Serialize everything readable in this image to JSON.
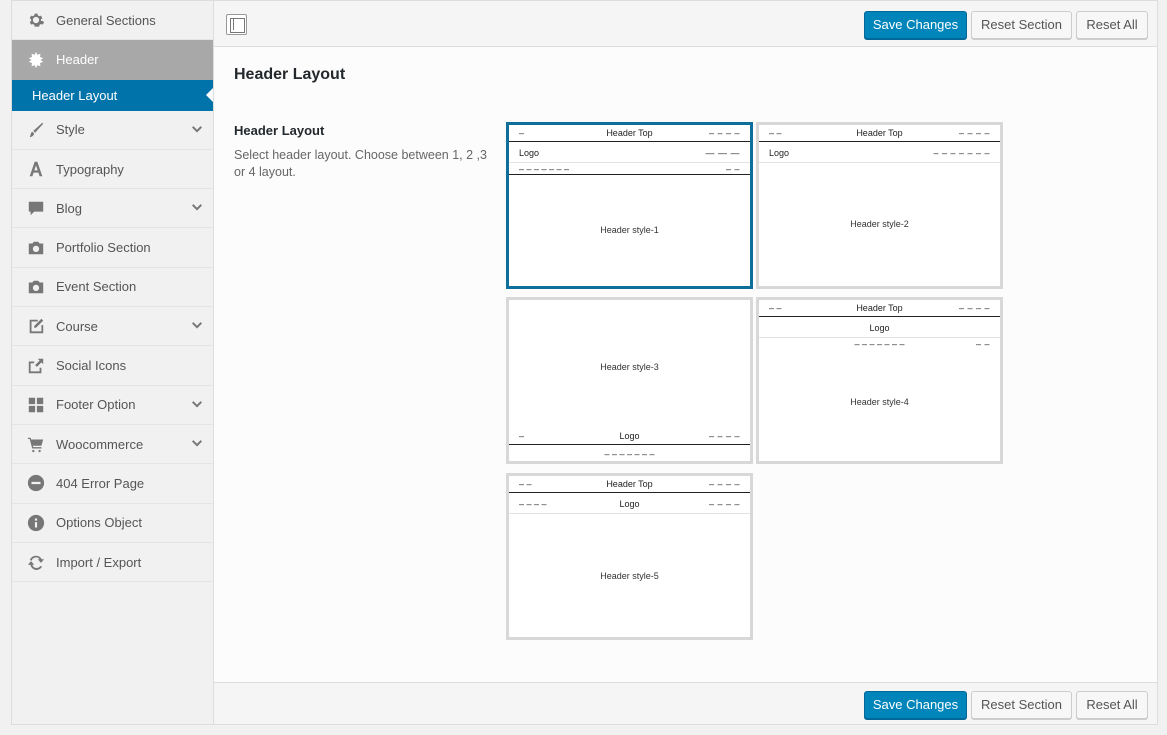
{
  "sidebar": {
    "items": [
      {
        "label": "General Sections",
        "icon": "gear-icon",
        "chevron": false
      },
      {
        "label": "Header",
        "icon": "sun-icon",
        "chevron": false,
        "active": true
      },
      {
        "label": "Style",
        "icon": "brush-icon",
        "chevron": true
      },
      {
        "label": "Typography",
        "icon": "font-icon",
        "chevron": false
      },
      {
        "label": "Blog",
        "icon": "comment-icon",
        "chevron": true
      },
      {
        "label": "Portfolio Section",
        "icon": "camera-icon",
        "chevron": false
      },
      {
        "label": "Event Section",
        "icon": "camera-icon",
        "chevron": false
      },
      {
        "label": "Course",
        "icon": "edit-icon",
        "chevron": true
      },
      {
        "label": "Social Icons",
        "icon": "share-icon",
        "chevron": false
      },
      {
        "label": "Footer Option",
        "icon": "grid-icon",
        "chevron": true
      },
      {
        "label": "Woocommerce",
        "icon": "cart-icon",
        "chevron": true
      },
      {
        "label": "404 Error Page",
        "icon": "minus-circle-icon",
        "chevron": false
      },
      {
        "label": "Options Object",
        "icon": "info-icon",
        "chevron": false
      },
      {
        "label": "Import / Export",
        "icon": "refresh-icon",
        "chevron": false
      }
    ],
    "sub_item": "Header Layout"
  },
  "toolbar": {
    "save_label": "Save Changes",
    "reset_section_label": "Reset Section",
    "reset_all_label": "Reset All"
  },
  "section": {
    "title": "Header Layout",
    "field_title": "Header Layout",
    "field_desc": "Select header layout. Choose between 1, 2 ,3 or 4 layout."
  },
  "layouts": {
    "selected": "Header style-1",
    "s1": {
      "top_left": "–",
      "top_center": "Header Top",
      "top_right": "– – – –",
      "logo": "Logo",
      "nav_right": "—  —  —",
      "menu_left": "– – – – – – –",
      "menu_right": "– –",
      "label": "Header style-1"
    },
    "s2": {
      "top_left": "– –",
      "top_center": "Header Top",
      "top_right": "– – – –",
      "logo": "Logo",
      "menu_right": "– – – – – – –",
      "label": "Header style-2"
    },
    "s3": {
      "label": "Header style-3",
      "bottom_left": "–",
      "bottom_center": "Logo",
      "bottom_right": "– – – –",
      "menu_center": "– – – – – – –"
    },
    "s4": {
      "top_left": "– –",
      "top_center": "Header Top",
      "top_right": "– – – –",
      "logo": "Logo",
      "menu_center": "– – – – – – –",
      "menu_right": "– –",
      "label": "Header style-4"
    },
    "s5": {
      "top_left": "– –",
      "top_center": "Header Top",
      "top_right": "– – – –",
      "row_left": "– – – –",
      "logo": "Logo",
      "row_right": "– – – –",
      "label": "Header style-5"
    }
  },
  "colors": {
    "accent": "#0073aa",
    "primary_button": "#0085ba",
    "selected_border": "#0e6f9b",
    "active_nav": "#a8a8a8"
  }
}
